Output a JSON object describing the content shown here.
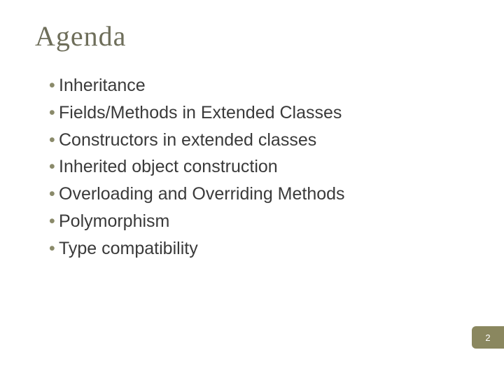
{
  "slide": {
    "title": "Agenda",
    "bullets": [
      "Inheritance",
      "Fields/Methods in Extended Classes",
      "Constructors in extended classes",
      "Inherited object construction",
      "Overloading and Overriding Methods",
      "Polymorphism",
      "Type compatibility"
    ],
    "page_number": "2"
  }
}
